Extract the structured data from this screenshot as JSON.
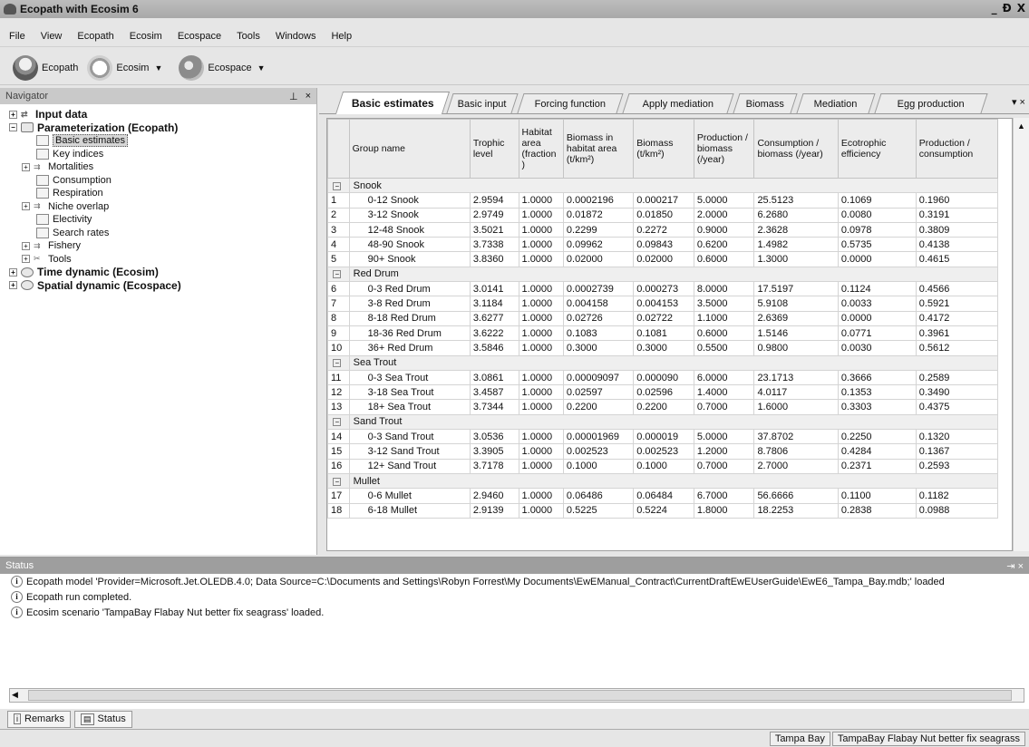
{
  "window": {
    "title": "Ecopath with Ecosim 6",
    "buttons": [
      "_",
      "Đ",
      "X"
    ]
  },
  "menu": [
    "File",
    "View",
    "Ecopath",
    "Ecosim",
    "Ecospace",
    "Tools",
    "Windows",
    "Help"
  ],
  "toolbar": {
    "ecopath": "Ecopath",
    "ecosim": "Ecosim",
    "ecospace": "Ecospace"
  },
  "navigator": {
    "title": "Navigator",
    "pin": "y",
    "close": "×",
    "items": [
      {
        "label": "Input data",
        "level": 1,
        "bold": true,
        "icon": "arrow-icon"
      },
      {
        "label": "Parameterization (Ecopath)",
        "level": 1,
        "bold": true,
        "icon": "folder-icon"
      },
      {
        "label": "Basic estimates",
        "level": 2,
        "selected": true,
        "icon": "page-icon"
      },
      {
        "label": "Key indices",
        "level": 2,
        "icon": "page-icon"
      },
      {
        "label": "Mortalities",
        "level": 2,
        "icon": "arrows-icon"
      },
      {
        "label": "Consumption",
        "level": 2,
        "icon": "page-icon"
      },
      {
        "label": "Respiration",
        "level": 2,
        "icon": "page-icon"
      },
      {
        "label": "Niche overlap",
        "level": 2,
        "icon": "arrows-icon"
      },
      {
        "label": "Electivity",
        "level": 2,
        "icon": "page-icon"
      },
      {
        "label": "Search rates",
        "level": 2,
        "icon": "page-icon"
      },
      {
        "label": "Fishery",
        "level": 2,
        "icon": "arrows-icon"
      },
      {
        "label": "Tools",
        "level": 2,
        "icon": "tools-icon"
      },
      {
        "label": "Time dynamic (Ecosim)",
        "level": 1,
        "bold": true,
        "icon": "clock-icon"
      },
      {
        "label": "Spatial dynamic  (Ecospace)",
        "level": 1,
        "bold": true,
        "icon": "globe-icon"
      }
    ]
  },
  "tabs": [
    "Basic estimates",
    "Basic input",
    "Forcing function",
    "Apply mediation",
    "Biomass",
    "Mediation",
    "Egg production"
  ],
  "tab_tools": "▾ ×",
  "grid": {
    "headers": [
      "",
      "Group name",
      "Trophic level",
      "Habitat area (fraction )",
      "Biomass in habitat area (t/km²)",
      "Biomass (t/km²)",
      "Production / biomass (/year)",
      "Consumption / biomass (/year)",
      "Ecotrophic efficiency",
      "Production / consumption"
    ],
    "rows": [
      {
        "group": "Snook"
      },
      {
        "cells": [
          "1",
          "0-12 Snook",
          "2.9594",
          "1.0000",
          "0.0002196",
          "0.000217",
          "5.0000",
          "25.5123",
          "0.1069",
          "0.1960"
        ]
      },
      {
        "cells": [
          "2",
          "3-12 Snook",
          "2.9749",
          "1.0000",
          "0.01872",
          "0.01850",
          "2.0000",
          "6.2680",
          "0.0080",
          "0.3191"
        ]
      },
      {
        "cells": [
          "3",
          "12-48 Snook",
          "3.5021",
          "1.0000",
          "0.2299",
          "0.2272",
          "0.9000",
          "2.3628",
          "0.0978",
          "0.3809"
        ]
      },
      {
        "cells": [
          "4",
          "48-90 Snook",
          "3.7338",
          "1.0000",
          "0.09962",
          "0.09843",
          "0.6200",
          "1.4982",
          "0.5735",
          "0.4138"
        ]
      },
      {
        "cells": [
          "5",
          "90+ Snook",
          "3.8360",
          "1.0000",
          "0.02000",
          "0.02000",
          "0.6000",
          "1.3000",
          "0.0000",
          "0.4615"
        ]
      },
      {
        "group": "Red Drum"
      },
      {
        "cells": [
          "6",
          "0-3 Red Drum",
          "3.0141",
          "1.0000",
          "0.0002739",
          "0.000273",
          "8.0000",
          "17.5197",
          "0.1124",
          "0.4566"
        ]
      },
      {
        "cells": [
          "7",
          "3-8 Red Drum",
          "3.1184",
          "1.0000",
          "0.004158",
          "0.004153",
          "3.5000",
          "5.9108",
          "0.0033",
          "0.5921"
        ]
      },
      {
        "cells": [
          "8",
          "8-18 Red Drum",
          "3.6277",
          "1.0000",
          "0.02726",
          "0.02722",
          "1.1000",
          "2.6369",
          "0.0000",
          "0.4172"
        ]
      },
      {
        "cells": [
          "9",
          "18-36 Red Drum",
          "3.6222",
          "1.0000",
          "0.1083",
          "0.1081",
          "0.6000",
          "1.5146",
          "0.0771",
          "0.3961"
        ]
      },
      {
        "cells": [
          "10",
          "36+ Red Drum",
          "3.5846",
          "1.0000",
          "0.3000",
          "0.3000",
          "0.5500",
          "0.9800",
          "0.0030",
          "0.5612"
        ]
      },
      {
        "group": "Sea Trout"
      },
      {
        "cells": [
          "11",
          "0-3 Sea Trout",
          "3.0861",
          "1.0000",
          "0.00009097",
          "0.000090",
          "6.0000",
          "23.1713",
          "0.3666",
          "0.2589"
        ]
      },
      {
        "cells": [
          "12",
          "3-18 Sea Trout",
          "3.4587",
          "1.0000",
          "0.02597",
          "0.02596",
          "1.4000",
          "4.0117",
          "0.1353",
          "0.3490"
        ]
      },
      {
        "cells": [
          "13",
          "18+ Sea Trout",
          "3.7344",
          "1.0000",
          "0.2200",
          "0.2200",
          "0.7000",
          "1.6000",
          "0.3303",
          "0.4375"
        ]
      },
      {
        "group": "Sand Trout"
      },
      {
        "cells": [
          "14",
          "0-3 Sand Trout",
          "3.0536",
          "1.0000",
          "0.00001969",
          "0.000019",
          "5.0000",
          "37.8702",
          "0.2250",
          "0.1320"
        ]
      },
      {
        "cells": [
          "15",
          "3-12 Sand Trout",
          "3.3905",
          "1.0000",
          "0.002523",
          "0.002523",
          "1.2000",
          "8.7806",
          "0.4284",
          "0.1367"
        ]
      },
      {
        "cells": [
          "16",
          "12+ Sand Trout",
          "3.7178",
          "1.0000",
          "0.1000",
          "0.1000",
          "0.7000",
          "2.7000",
          "0.2371",
          "0.2593"
        ]
      },
      {
        "group": "Mullet"
      },
      {
        "cells": [
          "17",
          "0-6 Mullet",
          "2.9460",
          "1.0000",
          "0.06486",
          "0.06484",
          "6.7000",
          "56.6666",
          "0.1100",
          "0.1182"
        ]
      },
      {
        "cells": [
          "18",
          "6-18 Mullet",
          "2.9139",
          "1.0000",
          "0.5225",
          "0.5224",
          "1.8000",
          "18.2253",
          "0.2838",
          "0.0988"
        ]
      }
    ]
  },
  "status": {
    "title": "Status",
    "pin": "⇥ ×",
    "messages": [
      "Ecopath model 'Provider=Microsoft.Jet.OLEDB.4.0; Data Source=C:\\Documents and Settings\\Robyn Forrest\\My Documents\\EwEManual_Contract\\CurrentDraftEwEUserGuide\\EwE6_Tampa_Bay.mdb;' loaded",
      "Ecopath run completed.",
      "Ecosim scenario 'TampaBay Flabay Nut better fix seagrass' loaded."
    ]
  },
  "bottom_tabs": [
    "Remarks",
    "Status"
  ],
  "statusbar": [
    "Tampa Bay",
    "TampaBay Flabay Nut better fix seagrass"
  ]
}
